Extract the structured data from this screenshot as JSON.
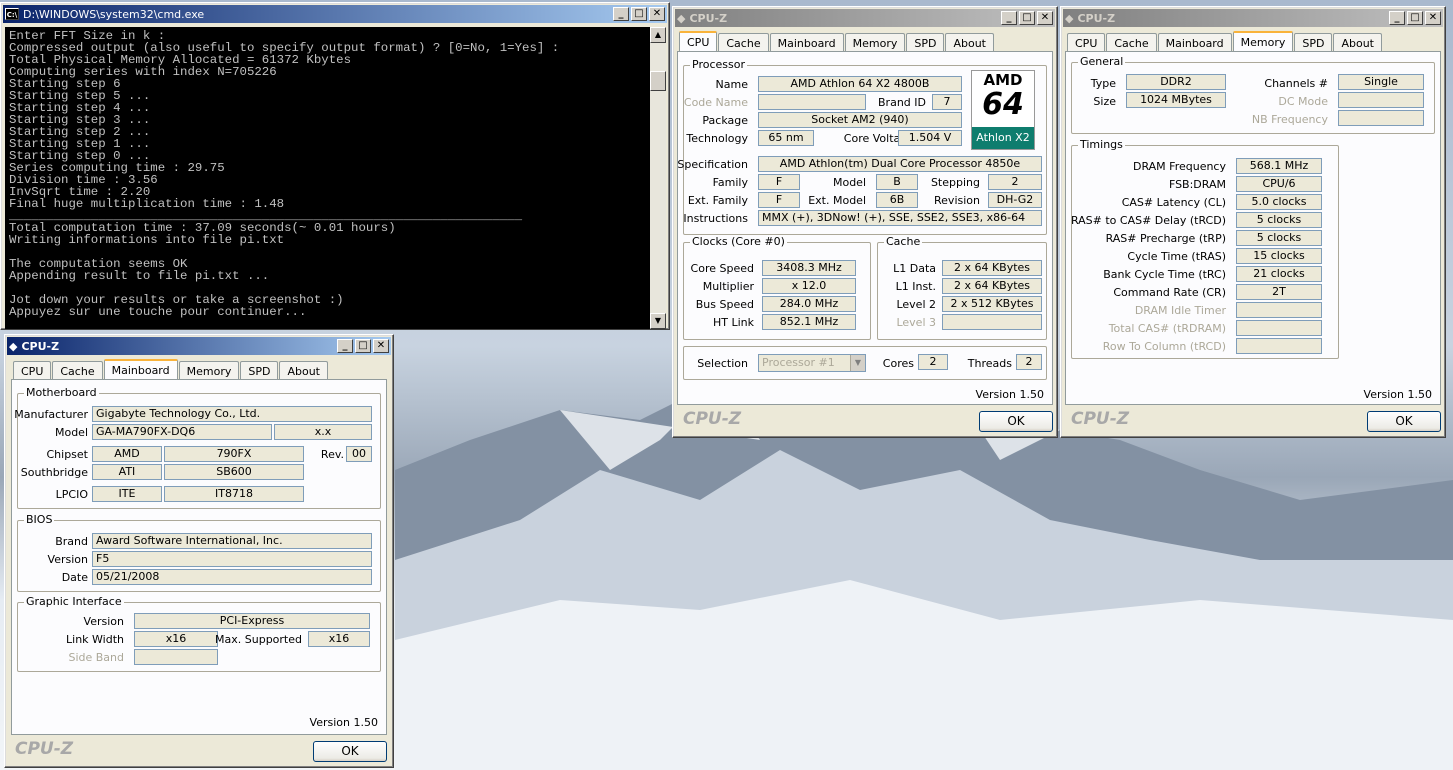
{
  "cmd": {
    "title": "D:\\WINDOWS\\system32\\cmd.exe",
    "lines": [
      "Enter FFT Size in k :",
      "Compressed output (also useful to specify output format) ? [0=No, 1=Yes] :",
      "Total Physical Memory Allocated = 61372 Kbytes",
      "Computing series with index N=705226",
      "Starting step 6",
      "Starting step 5 ...",
      "Starting step 4 ...",
      "Starting step 3 ...",
      "Starting step 2 ...",
      "Starting step 1 ...",
      "Starting step 0 ...",
      "Series computing time : 29.75",
      "Division time : 3.56",
      "InvSqrt time : 2.20",
      "Final huge multiplication time : 1.48",
      "_____________________________________________________________________",
      "Total computation time : 37.09 seconds(~ 0.01 hours)",
      "Writing informations into file pi.txt",
      "",
      "The computation seems OK",
      "Appending result to file pi.txt ...",
      "",
      "Jot down your results or take a screenshot :)",
      "Appuyez sur une touche pour continuer..."
    ]
  },
  "window_buttons": {
    "min": "_",
    "max": "□",
    "close": "✕"
  },
  "tabs": [
    "CPU",
    "Cache",
    "Mainboard",
    "Memory",
    "SPD",
    "About"
  ],
  "cpuz_title": "CPU-Z",
  "brand_logo": "CPU-Z",
  "version": "Version 1.50",
  "ok": "OK",
  "cpu": {
    "processor_group": "Processor",
    "name_label": "Name",
    "name": "AMD Athlon 64 X2 4800B",
    "codename_label": "Code Name",
    "codename": "",
    "brandid_label": "Brand ID",
    "brandid": "7",
    "package_label": "Package",
    "package": "Socket AM2 (940)",
    "technology_label": "Technology",
    "technology": "65 nm",
    "voltage_label": "Core Voltage",
    "voltage": "1.504 V",
    "spec_label": "Specification",
    "spec": "AMD Athlon(tm) Dual Core Processor 4850e",
    "family_label": "Family",
    "family": "F",
    "model_label": "Model",
    "model": "B",
    "stepping_label": "Stepping",
    "stepping": "2",
    "extfamily_label": "Ext. Family",
    "extfamily": "F",
    "extmodel_label": "Ext. Model",
    "extmodel": "6B",
    "revision_label": "Revision",
    "revision": "DH-G2",
    "instr_label": "Instructions",
    "instr": "MMX (+), 3DNow! (+), SSE, SSE2, SSE3, x86-64",
    "clocks_group": "Clocks (Core #0)",
    "corespeed_label": "Core Speed",
    "corespeed": "3408.3 MHz",
    "multiplier_label": "Multiplier",
    "multiplier": "x 12.0",
    "busspeed_label": "Bus Speed",
    "busspeed": "284.0 MHz",
    "htlink_label": "HT Link",
    "htlink": "852.1 MHz",
    "cache_group": "Cache",
    "l1data_label": "L1 Data",
    "l1data": "2 x 64 KBytes",
    "l1inst_label": "L1 Inst.",
    "l1inst": "2 x 64 KBytes",
    "level2_label": "Level 2",
    "level2": "2 x 512 KBytes",
    "level3_label": "Level 3",
    "level3": "",
    "selection_label": "Selection",
    "selection": "Processor #1",
    "cores_label": "Cores",
    "cores": "2",
    "threads_label": "Threads",
    "threads": "2",
    "amd_logo": {
      "top": "AMD",
      "mid": "64",
      "bottom": "Athlon X2"
    }
  },
  "memory": {
    "general_group": "General",
    "type_label": "Type",
    "type": "DDR2",
    "size_label": "Size",
    "size": "1024 MBytes",
    "channels_label": "Channels #",
    "channels": "Single",
    "dcmode_label": "DC Mode",
    "dcmode": "",
    "nbfreq_label": "NB Frequency",
    "nbfreq": "",
    "timings_group": "Timings",
    "rows": [
      {
        "label": "DRAM Frequency",
        "value": "568.1 MHz",
        "disabled": false
      },
      {
        "label": "FSB:DRAM",
        "value": "CPU/6",
        "disabled": false
      },
      {
        "label": "CAS# Latency (CL)",
        "value": "5.0 clocks",
        "disabled": false
      },
      {
        "label": "RAS# to CAS# Delay (tRCD)",
        "value": "5 clocks",
        "disabled": false
      },
      {
        "label": "RAS# Precharge (tRP)",
        "value": "5 clocks",
        "disabled": false
      },
      {
        "label": "Cycle Time (tRAS)",
        "value": "15 clocks",
        "disabled": false
      },
      {
        "label": "Bank Cycle Time (tRC)",
        "value": "21 clocks",
        "disabled": false
      },
      {
        "label": "Command Rate (CR)",
        "value": "2T",
        "disabled": false
      },
      {
        "label": "DRAM Idle Timer",
        "value": "",
        "disabled": true
      },
      {
        "label": "Total CAS# (tRDRAM)",
        "value": "",
        "disabled": true
      },
      {
        "label": "Row To Column (tRCD)",
        "value": "",
        "disabled": true
      }
    ]
  },
  "mainboard": {
    "motherboard_group": "Motherboard",
    "manufacturer_label": "Manufacturer",
    "manufacturer": "Gigabyte Technology Co., Ltd.",
    "model_label": "Model",
    "model": "GA-MA790FX-DQ6",
    "model_rev": "x.x",
    "chipset_label": "Chipset",
    "chipset_vendor": "AMD",
    "chipset": "790FX",
    "rev_label": "Rev.",
    "rev": "00",
    "southbridge_label": "Southbridge",
    "southbridge_vendor": "ATI",
    "southbridge": "SB600",
    "lpcio_label": "LPCIO",
    "lpcio_vendor": "ITE",
    "lpcio": "IT8718",
    "bios_group": "BIOS",
    "brand_label": "Brand",
    "brand": "Award Software International, Inc.",
    "version_label": "Version",
    "bios_version": "F5",
    "date_label": "Date",
    "date": "05/21/2008",
    "graphic_group": "Graphic Interface",
    "gi_version_label": "Version",
    "gi_version": "PCI-Express",
    "linkwidth_label": "Link Width",
    "linkwidth": "x16",
    "maxsupported_label": "Max. Supported",
    "maxsupported": "x16",
    "sideband_label": "Side Band",
    "sideband": ""
  }
}
